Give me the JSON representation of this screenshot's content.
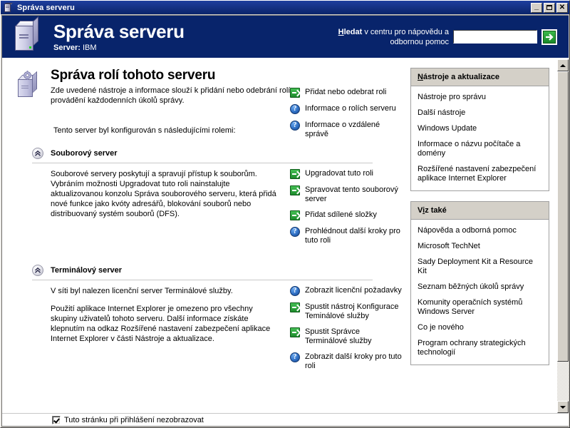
{
  "window": {
    "title": "Správa serveru",
    "icon": "server-icon",
    "minimize_label": "_",
    "maximize_label": "",
    "close_label": "✕"
  },
  "banner": {
    "icon": "server-tower-icon",
    "title": "Správa serveru",
    "server_label": "Server:",
    "server_name": "IBM",
    "search": {
      "label_bold": "Hledat",
      "label_rest": " v centru pro nápovědu a odbornou pomoc",
      "accel_letter": "H",
      "value": "",
      "placeholder": "",
      "go_icon": "green-arrow-icon"
    }
  },
  "page": {
    "icon": "server-gear-icon",
    "title": "Správa rolí tohoto serveru",
    "description": "Zde uvedené nástroje a informace slouží k přidání nebo odebrání rolí a provádění každodenních úkolů správy.",
    "configured_note": "Tento server byl konfigurován s následujícími rolemi:",
    "top_links": [
      {
        "icon": "green-arrow-icon",
        "label": "Přidat nebo odebrat roli"
      },
      {
        "icon": "help-question-icon",
        "label": "Informace o rolích serveru"
      },
      {
        "icon": "help-question-icon",
        "label": "Informace o vzdálené správě"
      }
    ]
  },
  "roles": [
    {
      "collapse_icon": "chevron-double-up-icon",
      "title": "Souborový server",
      "paragraphs": [
        "Souborové servery poskytují a spravují přístup k souborům. Vybráním možnosti Upgradovat tuto roli nainstalujte aktualizovanou konzolu Správa souborového serveru, která přidá nové funkce jako kvóty adresářů, blokování souborů nebo distribuovaný systém souborů (DFS)."
      ],
      "links": [
        {
          "icon": "green-arrow-icon",
          "label": "Upgradovat tuto roli"
        },
        {
          "icon": "green-arrow-icon",
          "label": "Spravovat tento souborový server"
        },
        {
          "icon": "green-arrow-icon",
          "label": "Přidat sdílené složky"
        },
        {
          "icon": "help-question-icon",
          "label": "Prohlédnout další kroky pro tuto roli"
        }
      ]
    },
    {
      "collapse_icon": "chevron-double-up-icon",
      "title": "Terminálový server",
      "paragraphs": [
        "V síti byl nalezen licenční server Terminálové služby.",
        "Použití aplikace Internet Explorer je omezeno pro všechny skupiny uživatelů tohoto serveru. Další informace získáte klepnutím na odkaz Rozšířené nastavení zabezpečení aplikace Internet Explorer v části Nástroje a aktualizace."
      ],
      "links": [
        {
          "icon": "help-question-icon",
          "label": "Zobrazit licenční požadavky"
        },
        {
          "icon": "green-arrow-icon",
          "label": "Spustit nástroj Konfigurace Teminálové služby"
        },
        {
          "icon": "green-arrow-icon",
          "label": "Spustit Správce Terminálové služby"
        },
        {
          "icon": "help-question-icon",
          "label": "Zobrazit další kroky pro tuto roli"
        }
      ]
    }
  ],
  "sidebar": {
    "panels": [
      {
        "title_accel": "N",
        "title_rest": "ástroje a aktualizace",
        "links": [
          "Nástroje pro správu",
          "Další nástroje",
          "Windows Update",
          "Informace o názvu počítače a domény",
          "Rozšířené nastavení zabezpečení aplikace Internet Explorer"
        ]
      },
      {
        "title_pre": "V",
        "title_accel": "i",
        "title_rest": "z také",
        "links": [
          "Nápověda a odborná pomoc",
          "Microsoft TechNet",
          "Sady Deployment Kit a Resource Kit",
          "Seznam běžných úkolů správy",
          "Komunity operačních systémů Windows Server",
          "Co je nového",
          "Program ochrany strategických technologií"
        ]
      }
    ]
  },
  "footer": {
    "checkbox_checked": true,
    "checkbox_label": "Tuto stránku při přihlášení nezobrazovat"
  },
  "scrollbar": {
    "up_icon": "arrow-up-icon",
    "down_icon": "arrow-down-icon"
  },
  "colors": {
    "banner_blue": "#08246b",
    "titlebar_blue": "#0a246a",
    "panel_header_gray": "#d4d0c8",
    "arrow_green": "#1d8c2c",
    "help_blue": "#2f6fc4"
  }
}
